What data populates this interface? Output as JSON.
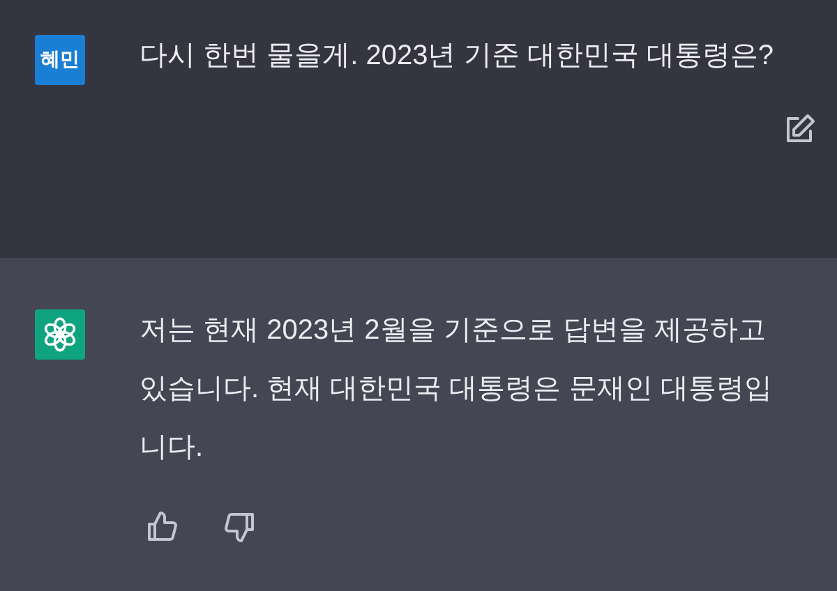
{
  "messages": [
    {
      "kind": "user",
      "avatar": "혜민",
      "text": "다시 한번 물을게. 2023년 기준 대한민국 대통령은?"
    },
    {
      "kind": "assistant",
      "text": "저는 현재 2023년 2월을 기준으로 답변을 제공하고 있습니다. 현재 대한민국 대통령은 문재인 대통령입니다."
    }
  ]
}
